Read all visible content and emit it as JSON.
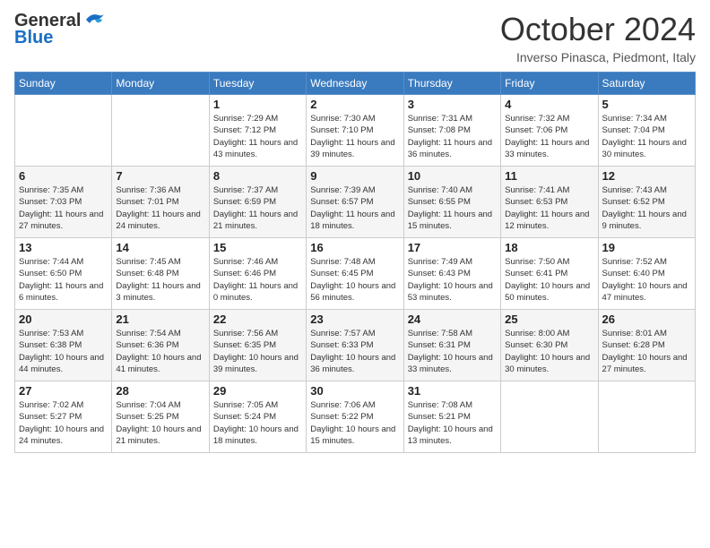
{
  "header": {
    "logo_general": "General",
    "logo_blue": "Blue",
    "title": "October 2024",
    "location": "Inverso Pinasca, Piedmont, Italy"
  },
  "days_of_week": [
    "Sunday",
    "Monday",
    "Tuesday",
    "Wednesday",
    "Thursday",
    "Friday",
    "Saturday"
  ],
  "weeks": [
    [
      {
        "day": "",
        "info": ""
      },
      {
        "day": "",
        "info": ""
      },
      {
        "day": "1",
        "info": "Sunrise: 7:29 AM\nSunset: 7:12 PM\nDaylight: 11 hours and 43 minutes."
      },
      {
        "day": "2",
        "info": "Sunrise: 7:30 AM\nSunset: 7:10 PM\nDaylight: 11 hours and 39 minutes."
      },
      {
        "day": "3",
        "info": "Sunrise: 7:31 AM\nSunset: 7:08 PM\nDaylight: 11 hours and 36 minutes."
      },
      {
        "day": "4",
        "info": "Sunrise: 7:32 AM\nSunset: 7:06 PM\nDaylight: 11 hours and 33 minutes."
      },
      {
        "day": "5",
        "info": "Sunrise: 7:34 AM\nSunset: 7:04 PM\nDaylight: 11 hours and 30 minutes."
      }
    ],
    [
      {
        "day": "6",
        "info": "Sunrise: 7:35 AM\nSunset: 7:03 PM\nDaylight: 11 hours and 27 minutes."
      },
      {
        "day": "7",
        "info": "Sunrise: 7:36 AM\nSunset: 7:01 PM\nDaylight: 11 hours and 24 minutes."
      },
      {
        "day": "8",
        "info": "Sunrise: 7:37 AM\nSunset: 6:59 PM\nDaylight: 11 hours and 21 minutes."
      },
      {
        "day": "9",
        "info": "Sunrise: 7:39 AM\nSunset: 6:57 PM\nDaylight: 11 hours and 18 minutes."
      },
      {
        "day": "10",
        "info": "Sunrise: 7:40 AM\nSunset: 6:55 PM\nDaylight: 11 hours and 15 minutes."
      },
      {
        "day": "11",
        "info": "Sunrise: 7:41 AM\nSunset: 6:53 PM\nDaylight: 11 hours and 12 minutes."
      },
      {
        "day": "12",
        "info": "Sunrise: 7:43 AM\nSunset: 6:52 PM\nDaylight: 11 hours and 9 minutes."
      }
    ],
    [
      {
        "day": "13",
        "info": "Sunrise: 7:44 AM\nSunset: 6:50 PM\nDaylight: 11 hours and 6 minutes."
      },
      {
        "day": "14",
        "info": "Sunrise: 7:45 AM\nSunset: 6:48 PM\nDaylight: 11 hours and 3 minutes."
      },
      {
        "day": "15",
        "info": "Sunrise: 7:46 AM\nSunset: 6:46 PM\nDaylight: 11 hours and 0 minutes."
      },
      {
        "day": "16",
        "info": "Sunrise: 7:48 AM\nSunset: 6:45 PM\nDaylight: 10 hours and 56 minutes."
      },
      {
        "day": "17",
        "info": "Sunrise: 7:49 AM\nSunset: 6:43 PM\nDaylight: 10 hours and 53 minutes."
      },
      {
        "day": "18",
        "info": "Sunrise: 7:50 AM\nSunset: 6:41 PM\nDaylight: 10 hours and 50 minutes."
      },
      {
        "day": "19",
        "info": "Sunrise: 7:52 AM\nSunset: 6:40 PM\nDaylight: 10 hours and 47 minutes."
      }
    ],
    [
      {
        "day": "20",
        "info": "Sunrise: 7:53 AM\nSunset: 6:38 PM\nDaylight: 10 hours and 44 minutes."
      },
      {
        "day": "21",
        "info": "Sunrise: 7:54 AM\nSunset: 6:36 PM\nDaylight: 10 hours and 41 minutes."
      },
      {
        "day": "22",
        "info": "Sunrise: 7:56 AM\nSunset: 6:35 PM\nDaylight: 10 hours and 39 minutes."
      },
      {
        "day": "23",
        "info": "Sunrise: 7:57 AM\nSunset: 6:33 PM\nDaylight: 10 hours and 36 minutes."
      },
      {
        "day": "24",
        "info": "Sunrise: 7:58 AM\nSunset: 6:31 PM\nDaylight: 10 hours and 33 minutes."
      },
      {
        "day": "25",
        "info": "Sunrise: 8:00 AM\nSunset: 6:30 PM\nDaylight: 10 hours and 30 minutes."
      },
      {
        "day": "26",
        "info": "Sunrise: 8:01 AM\nSunset: 6:28 PM\nDaylight: 10 hours and 27 minutes."
      }
    ],
    [
      {
        "day": "27",
        "info": "Sunrise: 7:02 AM\nSunset: 5:27 PM\nDaylight: 10 hours and 24 minutes."
      },
      {
        "day": "28",
        "info": "Sunrise: 7:04 AM\nSunset: 5:25 PM\nDaylight: 10 hours and 21 minutes."
      },
      {
        "day": "29",
        "info": "Sunrise: 7:05 AM\nSunset: 5:24 PM\nDaylight: 10 hours and 18 minutes."
      },
      {
        "day": "30",
        "info": "Sunrise: 7:06 AM\nSunset: 5:22 PM\nDaylight: 10 hours and 15 minutes."
      },
      {
        "day": "31",
        "info": "Sunrise: 7:08 AM\nSunset: 5:21 PM\nDaylight: 10 hours and 13 minutes."
      },
      {
        "day": "",
        "info": ""
      },
      {
        "day": "",
        "info": ""
      }
    ]
  ]
}
